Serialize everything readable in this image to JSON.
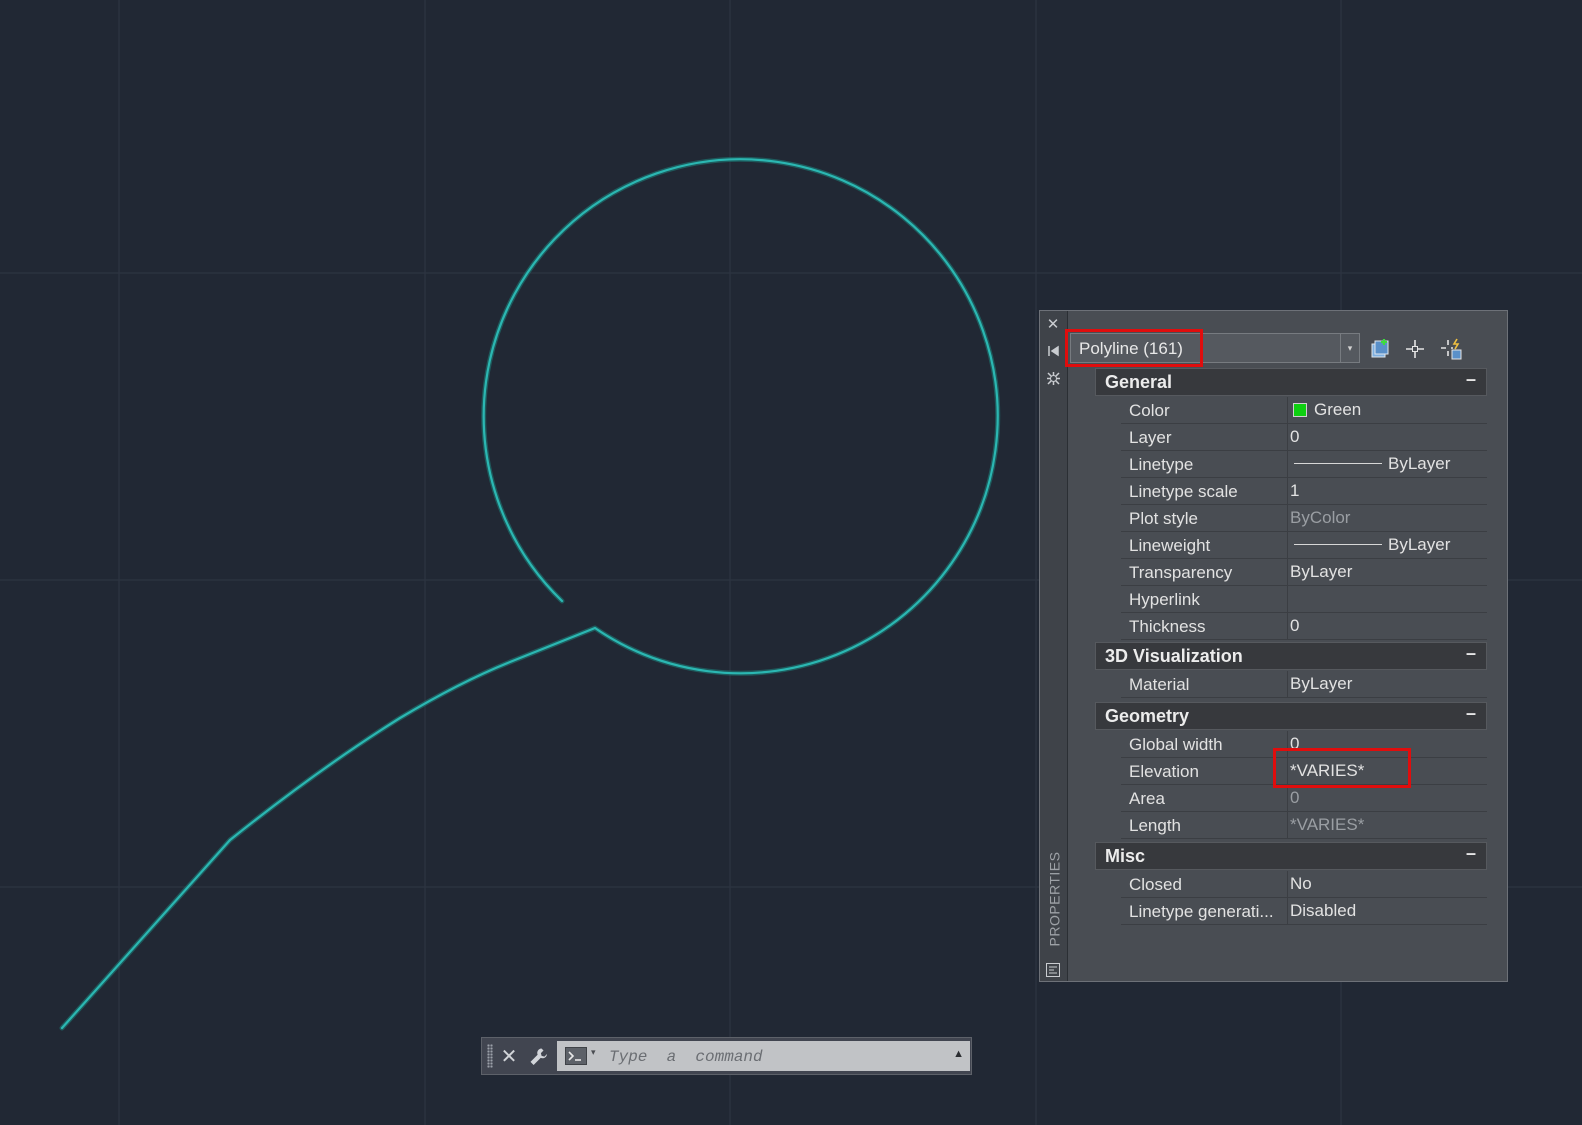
{
  "palette": {
    "title": "PROPERTIES",
    "selection": "Polyline (161)",
    "icons": [
      "close-icon",
      "auto-hide-icon",
      "palette-settings-icon",
      "quick-select-icon",
      "select-objects-icon",
      "toggle-pickadd-icon",
      "properties-palette-icon"
    ],
    "sections": [
      {
        "title": "General",
        "collapse": "–",
        "rows": [
          {
            "name": "Color",
            "value": "Green",
            "swatch": "#0ed010"
          },
          {
            "name": "Layer",
            "value": "0"
          },
          {
            "name": "Linetype",
            "value": "ByLayer",
            "line": true
          },
          {
            "name": "Linetype scale",
            "value": "1"
          },
          {
            "name": "Plot style",
            "value": "ByColor",
            "dim": true
          },
          {
            "name": "Lineweight",
            "value": "ByLayer",
            "line": true
          },
          {
            "name": "Transparency",
            "value": "ByLayer"
          },
          {
            "name": "Hyperlink",
            "value": ""
          },
          {
            "name": "Thickness",
            "value": "0"
          }
        ]
      },
      {
        "title": "3D Visualization",
        "collapse": "–",
        "rows": [
          {
            "name": "Material",
            "value": "ByLayer"
          }
        ]
      },
      {
        "title": "Geometry",
        "collapse": "–",
        "rows": [
          {
            "name": "Global width",
            "value": "0"
          },
          {
            "name": "Elevation",
            "value": "*VARIES*"
          },
          {
            "name": "Area",
            "value": "0",
            "dim": true
          },
          {
            "name": "Length",
            "value": "*VARIES*",
            "dim": true
          }
        ]
      },
      {
        "title": "Misc",
        "collapse": "–",
        "rows": [
          {
            "name": "Closed",
            "value": "No"
          },
          {
            "name": "Linetype  generati...",
            "value": "Disabled"
          }
        ]
      }
    ]
  },
  "command_line": {
    "placeholder": "Type  a  command",
    "icons": [
      "close-icon",
      "wrench-icon",
      "command-prompt-icon",
      "history-up-icon"
    ]
  },
  "colors": {
    "background": "#212834",
    "polyline": "#2bb7b2",
    "highlight": "#e00d0d"
  }
}
